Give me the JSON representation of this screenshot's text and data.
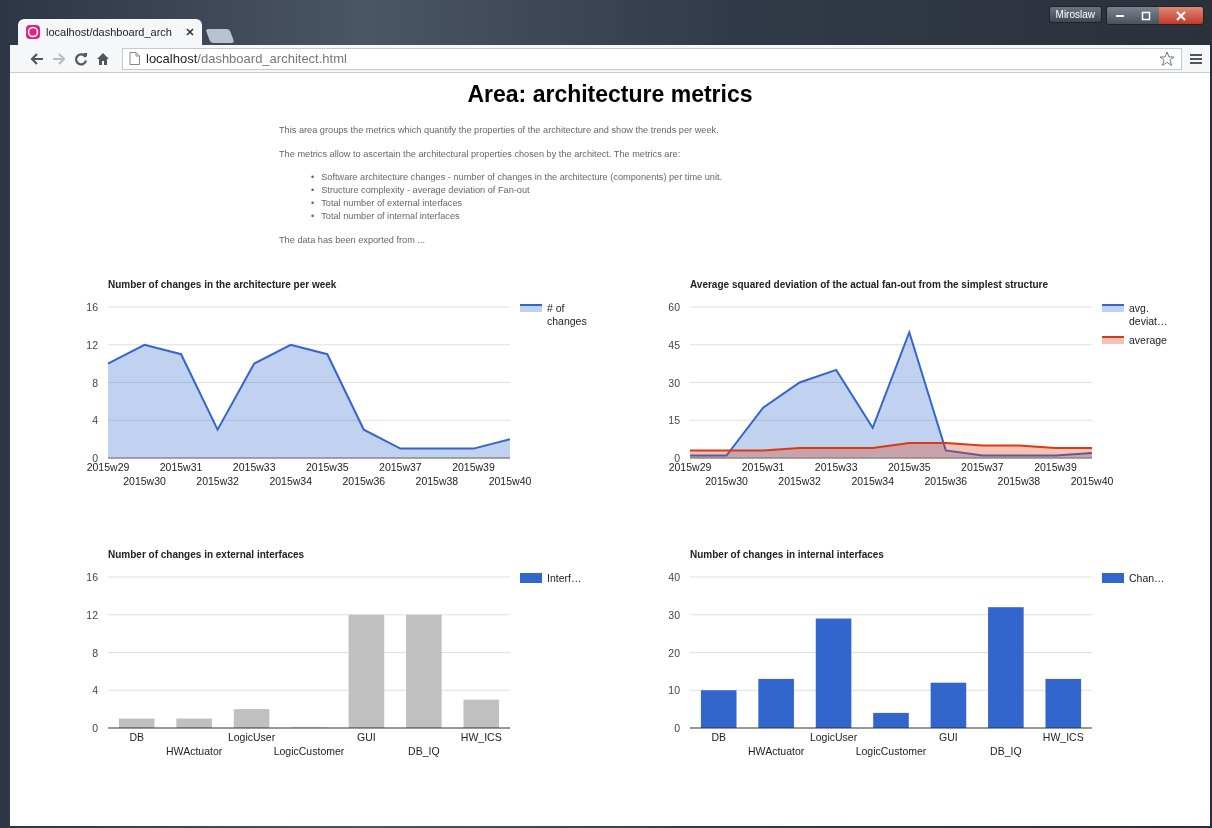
{
  "window": {
    "user": "Miroslaw"
  },
  "tab": {
    "title": "localhost/dashboard_arch",
    "selected": true
  },
  "address": {
    "host": "localhost",
    "path": "/dashboard_architect.html"
  },
  "nav": {
    "back_disabled": false,
    "forward_disabled": true
  },
  "page": {
    "title": "Area: architecture metrics",
    "intro": [
      "This area groups the metrics which quantify the properties of the architecture and show the trends per week.",
      "The metrics allow to ascertain the architectural properties chosen by the architect. The metrics are:"
    ],
    "bullets": [
      {
        "marker": "•",
        "text": "Software architecture changes - number of changes in the architecture (components) per time unit."
      },
      {
        "marker": "•",
        "text": "Structure complexity - average deviation of Fan-out"
      },
      {
        "marker": "•",
        "text": "Total number of external interfaces"
      },
      {
        "marker": "•",
        "text": "Total number of internal interfaces"
      }
    ],
    "outro": "The data has been exported from ..."
  },
  "charts": [
    {
      "chart_data": {
        "type": "area",
        "grid": true,
        "title": "Number of changes in the architecture per week",
        "categories": [
          "2015w29",
          "2015w30",
          "2015w31",
          "2015w32",
          "2015w33",
          "2015w34",
          "2015w35",
          "2015w36",
          "2015w37",
          "2015w38",
          "2015w39",
          "2015w40"
        ],
        "ylim": [
          0,
          16
        ],
        "yticks": [
          0,
          4,
          8,
          12,
          16
        ],
        "series": [
          {
            "name": "# of changes",
            "color": "#3366cc",
            "values": [
              10,
              12,
              11,
              3,
              10,
              12,
              11,
              3,
              1,
              1,
              1,
              2
            ]
          }
        ]
      }
    },
    {
      "chart_data": {
        "type": "area",
        "grid": true,
        "title": "Average squared deviation of the actual fan-out from the simplest structure",
        "categories": [
          "2015w29",
          "2015w30",
          "2015w31",
          "2015w32",
          "2015w33",
          "2015w34",
          "2015w35",
          "2015w36",
          "2015w37",
          "2015w38",
          "2015w39",
          "2015w40"
        ],
        "ylim": [
          0,
          60
        ],
        "yticks": [
          0,
          15,
          30,
          45,
          60
        ],
        "series": [
          {
            "name": "avg. deviat…",
            "color": "#3366cc",
            "values": [
              1,
              1,
              20,
              30,
              35,
              12,
              50,
              3,
              1,
              1,
              1,
              2
            ]
          },
          {
            "name": "average",
            "color": "#dc3912",
            "values": [
              3,
              3,
              3,
              4,
              4,
              4,
              6,
              6,
              5,
              5,
              4,
              4
            ]
          }
        ]
      }
    },
    {
      "legend": {
        "color": "#3366cc"
      },
      "chart_data": {
        "type": "bar",
        "grid": true,
        "title": "Number of changes in external interfaces",
        "categories": [
          "DB",
          "HWActuator",
          "LogicUser",
          "LogicCustomer",
          "GUI",
          "DB_IQ",
          "HW_ICS"
        ],
        "ylim": [
          0,
          16
        ],
        "yticks": [
          0,
          4,
          8,
          12,
          16
        ],
        "series": [
          {
            "name": "Interf…",
            "color": "#c0c0c0",
            "values": [
              1,
              1,
              2,
              0,
              12,
              12,
              3
            ]
          }
        ]
      }
    },
    {
      "chart_data": {
        "type": "bar",
        "grid": true,
        "title": "Number of changes in internal interfaces",
        "categories": [
          "DB",
          "HWActuator",
          "LogicUser",
          "LogicCustomer",
          "GUI",
          "DB_IQ",
          "HW_ICS"
        ],
        "ylim": [
          0,
          40
        ],
        "yticks": [
          0,
          10,
          20,
          30,
          40
        ],
        "series": [
          {
            "name": "Chan…",
            "color": "#3366cc",
            "values": [
              10,
              13,
              29,
              4,
              12,
              32,
              13
            ]
          }
        ]
      }
    }
  ]
}
